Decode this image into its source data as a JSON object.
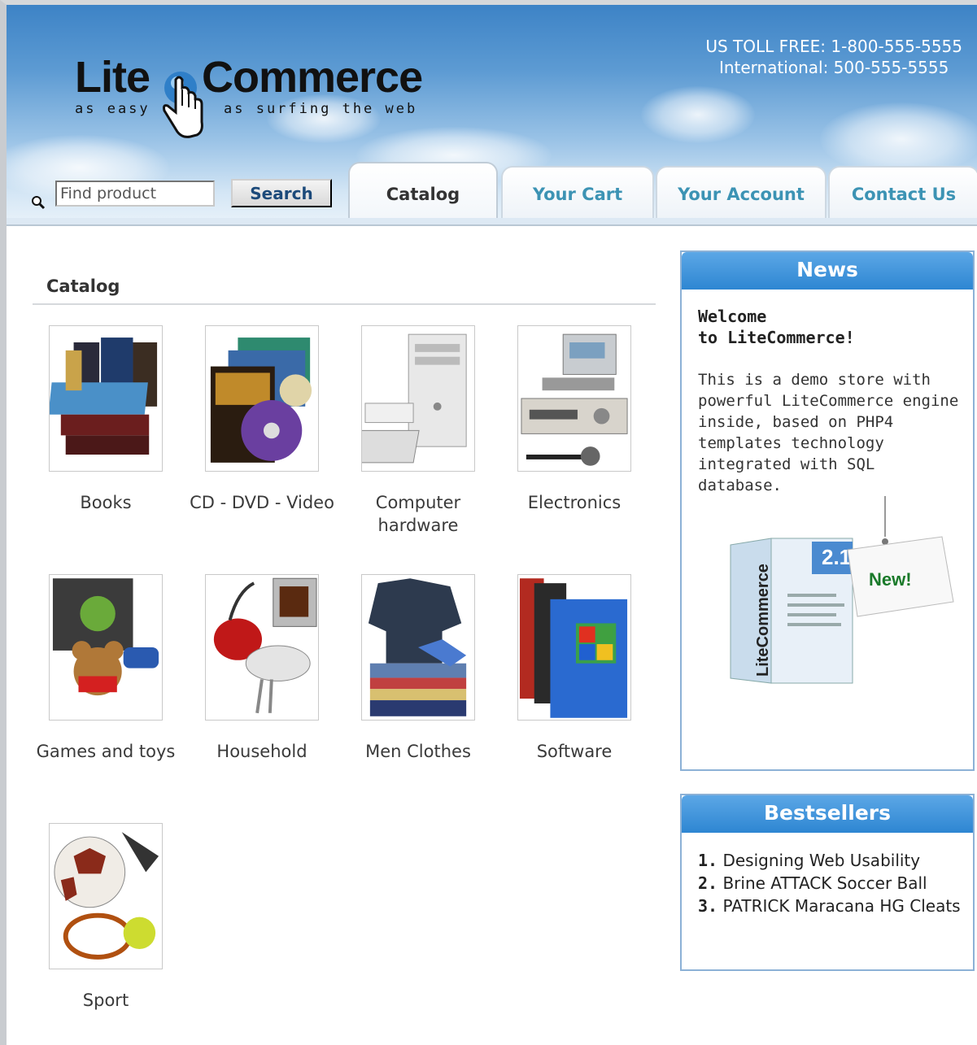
{
  "header": {
    "logo": {
      "word1": "Lite",
      "word2": "Commerce",
      "tagline1": "as easy",
      "tagline2": "as surfing the web"
    },
    "phones": {
      "toll_free": "US TOLL FREE: 1-800-555-5555",
      "international": "International: 500-555-5555"
    },
    "search": {
      "placeholder": "Find product",
      "value": "",
      "button_label": "Search",
      "icon": "magnifier-icon"
    },
    "tabs": [
      {
        "label": "Catalog",
        "active": true
      },
      {
        "label": "Your Cart",
        "active": false
      },
      {
        "label": "Your Account",
        "active": false
      },
      {
        "label": "Contact Us",
        "active": false
      }
    ]
  },
  "catalog": {
    "title": "Catalog",
    "categories": [
      {
        "label": "Books",
        "image": "books-image"
      },
      {
        "label": "CD - DVD - Video",
        "image": "cd-dvd-video-image"
      },
      {
        "label": "Computer hardware",
        "image": "computer-hardware-image"
      },
      {
        "label": "Electronics",
        "image": "electronics-image"
      },
      {
        "label": "Games and toys",
        "image": "games-toys-image"
      },
      {
        "label": "Household",
        "image": "household-image"
      },
      {
        "label": "Men Clothes",
        "image": "men-clothes-image"
      },
      {
        "label": "Software",
        "image": "software-image"
      },
      {
        "label": "Sport",
        "image": "sport-image"
      }
    ]
  },
  "news": {
    "heading": "News",
    "title_line1": "Welcome",
    "title_line2": "to LiteCommerce!",
    "body": "This is a demo store with powerful LiteCommerce engine inside, based on PHP4 templates technology integrated with SQL database.",
    "promo": {
      "version": "2.1",
      "badge": "New!",
      "box_brand": "LiteCommerce"
    }
  },
  "bestsellers": {
    "heading": "Bestsellers",
    "items": [
      {
        "num": "1.",
        "title": "Designing Web Usability"
      },
      {
        "num": "2.",
        "title": "Brine ATTACK Soccer Ball"
      },
      {
        "num": "3.",
        "title": "PATRICK Maracana HG Cleats"
      }
    ]
  },
  "colors": {
    "tab_text": "#3c93b4",
    "box_header": "#2e86d2",
    "box_border": "#8cb1d6"
  }
}
